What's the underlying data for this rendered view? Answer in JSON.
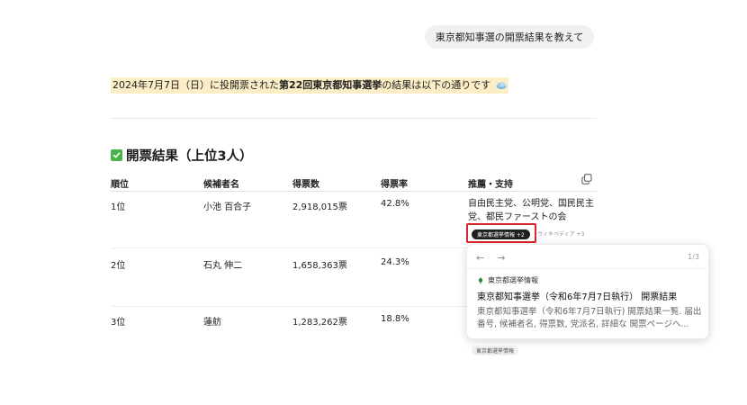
{
  "user_message": "東京都知事選の開票結果を教えて",
  "intro": {
    "prefix": "2024年7月7日（日）に投開票された",
    "bold": "第22回東京都知事選挙",
    "suffix": "の結果は以下の通りです"
  },
  "section_title": "開票結果（上位3人）",
  "table": {
    "headers": [
      "順位",
      "候補者名",
      "得票数",
      "得票率",
      "推薦・支持"
    ],
    "rows": [
      {
        "rank": "1位",
        "name": "小池 百合子",
        "votes": "2,918,015票",
        "rate": "42.8%",
        "support": "自由民主党、公明党、国民民主党、都民ファーストの会"
      },
      {
        "rank": "2位",
        "name": "石丸 伸二",
        "votes": "1,658,363票",
        "rate": "24.3%",
        "support": ""
      },
      {
        "rank": "3位",
        "name": "蓮舫",
        "votes": "1,283,262票",
        "rate": "18.8%",
        "support": ""
      }
    ]
  },
  "citations": {
    "active_chip": "東京都選挙情報 +2",
    "secondary_chip": "ウィキペディア +3",
    "footer_chip": "東京都選挙情報"
  },
  "popover": {
    "page": "1/3",
    "source": "東京都選挙情報",
    "title": "東京都知事選挙（令和6年7月7日執行） 開票結果",
    "snippet": "東京都知事選挙（令和6年7月7日執行) 開票結果一覧. 届出番号, 候補者名, 得票数, 党派名, 詳細な 開票ページへ..."
  },
  "colors": {
    "highlight": "#fbeec6",
    "check": "#47b34a",
    "chip_dark": "#1f1f1f",
    "outline_red": "#d9262c",
    "leaf_green": "#2e8b3a"
  },
  "icons": [
    "cloud-icon",
    "check-icon",
    "copy-icon",
    "arrow-left-icon",
    "arrow-right-icon",
    "leaf-icon"
  ]
}
